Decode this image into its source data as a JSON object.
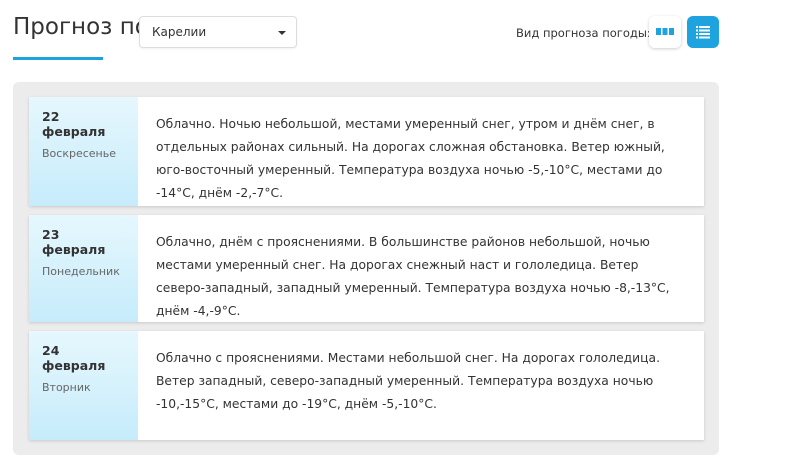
{
  "header": {
    "title": "Прогноз по",
    "region": "Карелии",
    "view_label": "Вид прогноза погоды:"
  },
  "colors": {
    "accent": "#1ea3de"
  },
  "days": [
    {
      "date": "22 февраля",
      "weekday": "Воскресенье",
      "text": "Облачно. Ночью небольшой, местами умеренный снег, утром и днём снег, в отдельных районах сильный. На дорогах сложная обстановка. Ветер южный, юго-восточный умеренный. Температура воздуха ночью -5,-10°С, местами до -14°С, днём -2,-7°С."
    },
    {
      "date": "23 февраля",
      "weekday": "Понедельник",
      "text": "Облачно, днём с прояснениями. В большинстве районов небольшой, ночью местами умеренный снег. На дорогах снежный наст и гололедица. Ветер северо-западный, западный умеренный. Температура воздуха ночью -8,-13°С, днём -4,-9°С."
    },
    {
      "date": "24 февраля",
      "weekday": "Вторник",
      "text": "Облачно с прояснениями. Местами небольшой снег. На дорогах гололедица. Ветер западный, северо-западный умеренный. Температура воздуха ночью -10,-15°С, местами до -19°С, днём -5,-10°С."
    }
  ]
}
